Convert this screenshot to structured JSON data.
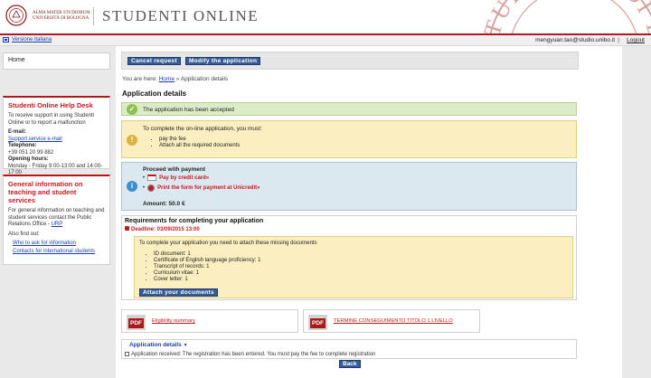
{
  "header": {
    "university_line1": "ALMA MATER STUDIORUM",
    "university_line2": "UNIVERSITÀ DI BOLOGNA",
    "portal_title": "STUDENTI ONLINE",
    "seal_text": "STUDIORUM DI BOLOGNA"
  },
  "topbar": {
    "language_link": "Versione italiana",
    "user_email": "mengyuan.tao@studio.unibo.it",
    "separator": "|",
    "logout": "Logout"
  },
  "sidebar": {
    "home": "Home",
    "help": {
      "title": "Studenti Online Help Desk",
      "text": "To receive support in using Studenti Online or to report a malfunction",
      "email_label": "E-mail:",
      "email_link": "Support service e-mail",
      "phone_label": "Telephone:",
      "phone": "+39 051 20 99 882",
      "hours_label": "Opening hours:",
      "hours": "Monday - Friday 9:00-13:00 and 14:00-17:00"
    },
    "general": {
      "title": "General information on teaching and student services",
      "text": "For general information on teaching and student services contact the Public Relations Office - ",
      "urp_link": "URP",
      "also": "Also find out:",
      "links": [
        "Who to ask for information",
        "Contacts for international students"
      ]
    }
  },
  "toolbar": {
    "cancel_request": "Cancel request",
    "modify_application": "Modify the application"
  },
  "breadcrumb": {
    "prefix": "You are here:",
    "home": "Home",
    "sep": "»",
    "current": "Application details"
  },
  "page_title": "Application details",
  "messages": {
    "accepted": "The application has been accepted",
    "todo_intro": "To complete the on-line application, you must:",
    "todo_items": [
      "pay the fee",
      "Attach all the required documents"
    ],
    "payment_title": "Proceed with payment",
    "pay_card": "Pay by credit card»",
    "print_form": "Print the form for payment at Unicredit»",
    "amount": "Amount: 50.0 €"
  },
  "requirements": {
    "title": "Requirements for completing your application",
    "deadline": "Deadline: 03/09/2015 13:00",
    "missing_intro": "To complete your application you need to attach these missing documents",
    "items": [
      "ID document: 1",
      "Certificate of English language proficiency: 1",
      "Transcript of records: 1",
      "Curriculum vitae: 1",
      "Cover letter: 1"
    ],
    "attach_button": "Attach your documents"
  },
  "documents": [
    {
      "icon_label": "PDF",
      "link": "Eligibility summary"
    },
    {
      "icon_label": "PDF",
      "link": "TERMINE CONSEGUIMENTO TITOLO 1 LIVELLO"
    }
  ],
  "application_details": {
    "title": "Application details",
    "text": "Application received: The registration has been entered. You must pay the fee to complete registration"
  },
  "back_button": "Back",
  "colors": {
    "brand_red": "#b8141b",
    "button_blue": "#365c98",
    "success_bg": "#dcecc6",
    "warning_bg": "#fbeec0",
    "info_bg": "#dbe8ef"
  }
}
